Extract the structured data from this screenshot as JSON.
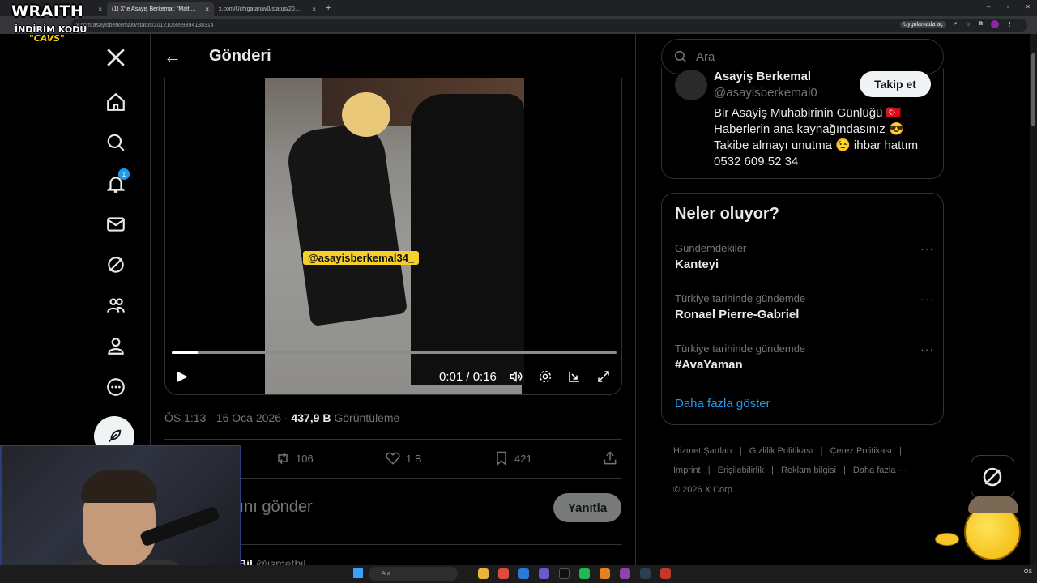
{
  "browser": {
    "tabs": [
      {
        "label": "",
        "close": "×"
      },
      {
        "label": "(1) X'te Asayiş Berkemal: \"Malti…",
        "close": "×"
      },
      {
        "label": "x.com/Uchigatanav0/status/20…",
        "close": "×"
      }
    ],
    "new_tab": "+",
    "url": "x.com/asayisberkemal0/status/2012105899394138314",
    "app_pill": "Uygulamada aç"
  },
  "overlay": {
    "logo": "WRAITH",
    "code_label": "İNDİRİM KODU",
    "code": "\"CAVS\""
  },
  "nav": {
    "notification_count": "1"
  },
  "header": {
    "title": "Gönderi"
  },
  "video": {
    "watermark": "@asayisberkemal34_",
    "time": "0:01 / 0:16",
    "progress": 0.06
  },
  "post": {
    "time": "ÖS 1:13 · 16 Oca 2026 ·",
    "views_count": "437,9 B",
    "views_label": "Görüntüleme",
    "retweets": "106",
    "likes": "1 B",
    "bookmarks": "421"
  },
  "reply": {
    "placeholder": "tını gönder",
    "button": "Yanıtla"
  },
  "next_post": {
    "name": "Bil",
    "handle": "@ismetbil…"
  },
  "search": {
    "placeholder": "Ara"
  },
  "profile": {
    "name": "Asayiş Berkemal",
    "handle": "@asayisberkemal0",
    "follow": "Takip et",
    "bio": [
      "Bir Asayiş Muhabirinin Günlüğü 🇹🇷",
      "Haberlerin ana kaynağındasınız 😎",
      "Takibe almayı unutma 😉 ihbar hattım",
      "0532 609 52 34"
    ]
  },
  "trends": {
    "title": "Neler oluyor?",
    "items": [
      {
        "context": "Gündemdekiler",
        "name": "Kanteyi"
      },
      {
        "context": "Türkiye tarihinde gündemde",
        "name": "Ronael Pierre-Gabriel"
      },
      {
        "context": "Türkiye tarihinde gündemde",
        "name": "#AvaYaman"
      }
    ],
    "more_icon": "···",
    "show_more": "Daha fazla göster"
  },
  "footer": {
    "links": [
      "Hizmet Şartları",
      "|",
      "Gizlilik Politikası",
      "|",
      "Çerez Politikası",
      "|",
      "Imprint",
      "|",
      "Erişilebilirlik",
      "|",
      "Reklam bilgisi",
      "|",
      "Daha fazla ···"
    ],
    "copyright": "© 2026 X Corp."
  },
  "taskbar": {
    "search": "Ara",
    "clock": "ÖS"
  },
  "colors": {
    "accent": "#1d9bf0",
    "background": "#000000",
    "border": "#2f3336",
    "muted": "#71767b"
  }
}
